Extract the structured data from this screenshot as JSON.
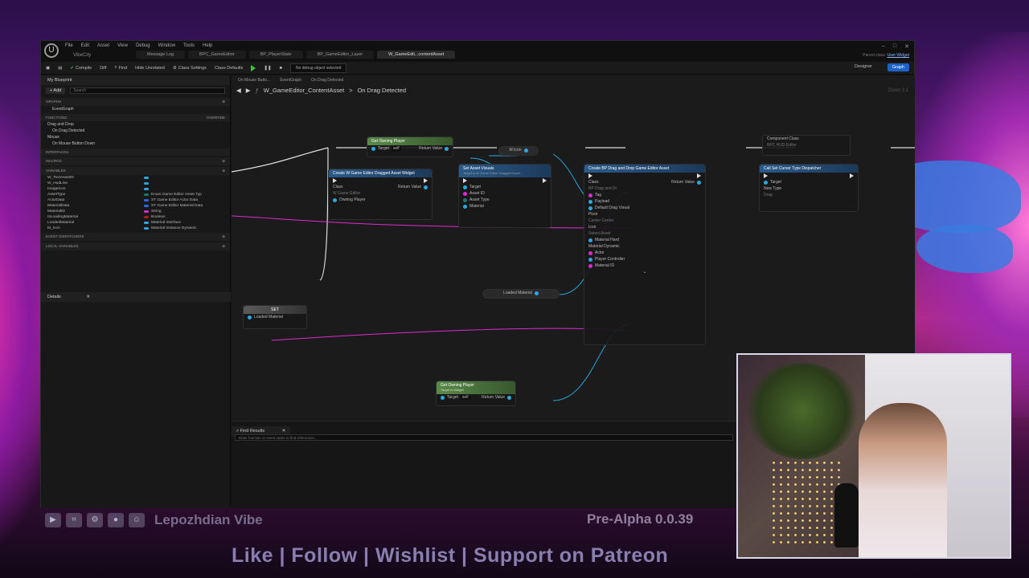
{
  "window": {
    "menu": [
      "File",
      "Edit",
      "Asset",
      "View",
      "Debug",
      "Window",
      "Tools",
      "Help"
    ],
    "project_name": "VibeCity",
    "tabs": [
      {
        "label": "Message Log",
        "active": false
      },
      {
        "label": "BPC_GameEditor",
        "active": false
      },
      {
        "label": "BP_PlayerState",
        "active": false
      },
      {
        "label": "BP_GameEditor_Layer",
        "active": false
      },
      {
        "label": "W_GameEdit...contentAsset",
        "active": true
      }
    ],
    "parent_class_label": "Parent class:",
    "parent_class_value": "User Widget"
  },
  "toolbar": {
    "compile": "Compile",
    "diff": "Diff",
    "find": "Find",
    "hide_unrelated": "Hide Unrelated",
    "class_settings": "Class Settings",
    "class_defaults": "Class Defaults",
    "debug_object": "No debug object selected",
    "designer": "Designer",
    "graph": "Graph"
  },
  "my_blueprint": {
    "title": "My Blueprint",
    "add_label": "+ Add",
    "search_placeholder": "Search",
    "graphs_label": "GRAPHS",
    "event_graph": "EventGraph",
    "functions_label": "FUNCTIONS",
    "override_label": "Override",
    "drag_drop_label": "Drag and Drop",
    "on_drag_detected": "On Drag Detected",
    "mouse_label": "Mouse",
    "on_mouse_button_down": "On Mouse Button Down",
    "interfaces_label": "INTERFACES",
    "macros_label": "MACROS",
    "variables_label": "VARIABLES",
    "variables": [
      {
        "name": "W_TextAssetID",
        "type": "",
        "color": "#2aa8e0"
      },
      {
        "name": "W_HudLine",
        "type": "",
        "color": "#2aa8e0"
      },
      {
        "name": "ImageIcon",
        "type": "",
        "color": "#2aa8e0"
      },
      {
        "name": "AssetType",
        "type": "Enum Game Editor Asset Typ",
        "color": "#1a7a6a"
      },
      {
        "name": "ActorData",
        "type": "ST Game Editor Actor Data",
        "color": "#2a6ae0"
      },
      {
        "name": "MaterialData",
        "type": "ST Game Editor Material Data",
        "color": "#2a6ae0"
      },
      {
        "name": "MaterialID",
        "type": "String",
        "color": "#e02ad0"
      },
      {
        "name": "IsLoadingMaterial",
        "type": "Boolean",
        "color": "#b01a1a"
      },
      {
        "name": "LoadedMaterial",
        "type": "Material Interface",
        "color": "#2aa8e0"
      },
      {
        "name": "M_Icon",
        "type": "Material Instance Dynamic",
        "color": "#2aa8e0"
      }
    ],
    "event_dispatchers_label": "EVENT DISPATCHERS",
    "local_variables_label": "LOCAL VARIABLES"
  },
  "details": {
    "title": "Details"
  },
  "graph": {
    "tabs": [
      "On Mouse Butto...",
      "EventGraph",
      "On Drag Detected"
    ],
    "breadcrumb_root": "W_GameEditor_ContentAsset",
    "breadcrumb_leaf": "On Drag Detected",
    "zoom": "Zoom 1:1",
    "nodes": {
      "get_owning_player_top": {
        "title": "Get Owning Player",
        "target": "Target",
        "self": "self",
        "return": "Return Value"
      },
      "m_icon": {
        "title": "M Icon"
      },
      "create_widget": {
        "title": "Create W Game Editor Dragged Asset Widget",
        "class": "Class",
        "class_value": "W Game Editor",
        "return": "Return Value",
        "owning_player": "Owning Player"
      },
      "set_visuals": {
        "title": "Set Asset Visuals",
        "subtitle": "Target is W Game Editor Dragged Asset",
        "target": "Target",
        "asset_id": "Asset ID",
        "asset_type": "Asset Type",
        "material": "Material"
      },
      "create_dd": {
        "title": "Create BP Drag and Drop Game Editor Asset",
        "class": "Class",
        "class_value": "BP Drag and Dr",
        "return": "Return Value",
        "tag": "Tag",
        "payload": "Payload",
        "default_visual": "Default Drag Visual",
        "pivot": "Pivot",
        "pivot_value": "Center Center",
        "icon": "Icon",
        "icon_value": "Select Asset",
        "material_hard": "Material Hard",
        "material_dynamic": "Material Dynamic",
        "actor": "Actor",
        "player_controller": "Player Controller",
        "material_id": "Material ID"
      },
      "cursor_dispatcher": {
        "title": "Call Set Cursor Type Dispatcher",
        "target": "Target",
        "component_class": "Component Class",
        "component_value": "BPC HUD Editor",
        "new_type": "New Type",
        "new_type_value": "Drag"
      },
      "loaded_material": {
        "title": "Loaded Material"
      },
      "set_node": {
        "title": "SET",
        "pin": "Loaded Material"
      },
      "get_owning_player_bottom": {
        "title": "Get Owning Player",
        "subtitle": "Target is Widget",
        "target": "Target",
        "self": "self",
        "return": "Return Value"
      }
    }
  },
  "find_results": {
    "title": "Find Results",
    "placeholder": "Enter function or event name to find references..."
  },
  "overlay": {
    "streamer_name": "Lepozhdian Vibe",
    "version": "Pre-Alpha 0.0.39",
    "call_to_action": "Like | Follow | Wishlist | Support on Patreon",
    "social_icons": [
      "youtube-icon",
      "twitch-icon",
      "steam-icon",
      "patreon-icon",
      "discord-icon"
    ]
  }
}
